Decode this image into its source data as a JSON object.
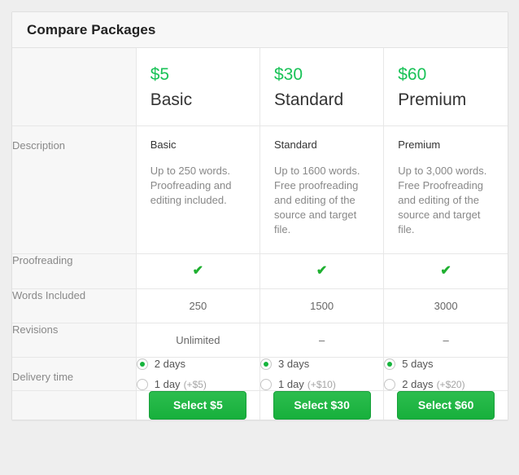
{
  "card": {
    "title": "Compare Packages"
  },
  "columns": [
    {
      "price": "$5",
      "name": "Basic",
      "select_label": "Select $5"
    },
    {
      "price": "$30",
      "name": "Standard",
      "select_label": "Select $30"
    },
    {
      "price": "$60",
      "name": "Premium",
      "select_label": "Select $60"
    }
  ],
  "rows": {
    "description": {
      "label": "Description",
      "cells": [
        {
          "title": "Basic",
          "body": "Up to 250 words. Proofreading and editing included."
        },
        {
          "title": "Standard",
          "body": "Up to 1600 words. Free proofreading and editing of the source and target file."
        },
        {
          "title": "Premium",
          "body": "Up to 3,000 words. Free Proofreading and editing of the source and target file."
        }
      ]
    },
    "proofreading": {
      "label": "Proofreading",
      "cells": [
        "check-icon",
        "check-icon",
        "check-icon"
      ],
      "glyph": "✔"
    },
    "words_included": {
      "label": "Words Included",
      "cells": [
        "250",
        "1500",
        "3000"
      ]
    },
    "revisions": {
      "label": "Revisions",
      "cells": [
        "Unlimited",
        "–",
        "–"
      ]
    },
    "delivery_time": {
      "label": "Delivery time",
      "cells": [
        {
          "options": [
            {
              "text": "2 days",
              "extra": "",
              "selected": true
            },
            {
              "text": "1 day",
              "extra": "(+$5)",
              "selected": false
            }
          ]
        },
        {
          "options": [
            {
              "text": "3 days",
              "extra": "",
              "selected": true
            },
            {
              "text": "1 day",
              "extra": "(+$10)",
              "selected": false
            }
          ]
        },
        {
          "options": [
            {
              "text": "5 days",
              "extra": "",
              "selected": true
            },
            {
              "text": "2 days",
              "extra": "(+$20)",
              "selected": false
            }
          ]
        }
      ]
    }
  },
  "colors": {
    "price_green": "#19c257",
    "button_green": "#1db344",
    "check_green": "#1eb030",
    "radio_green": "#16b43c",
    "label_gray": "#888888",
    "page_bg": "#eeeeee"
  }
}
